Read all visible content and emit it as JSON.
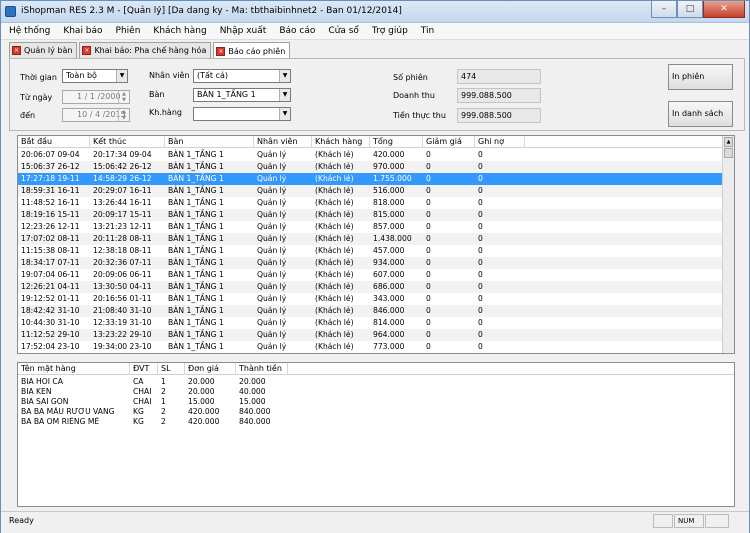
{
  "window": {
    "title": "iShopman RES 2.3 M - [Quản lý] [Da dang ky - Ma: tbthaibinhnet2 - Ban 01/12/2014]"
  },
  "menu": [
    "Hệ thống",
    "Khai báo",
    "Phiên",
    "Khách hàng",
    "Nhập xuất",
    "Báo cáo",
    "Cửa sổ",
    "Trợ giúp",
    "Tin"
  ],
  "tabs": [
    "Quản lý bàn",
    "Khai báo: Pha chế hàng hóa",
    "Báo cáo phiên"
  ],
  "filters": {
    "time_label": "Thời gian",
    "time_value": "Toàn bộ",
    "from_label": "Từ ngày",
    "from_value": "1 / 1 /2000",
    "to_label": "đến",
    "to_value": "10 / 4 /2015",
    "staff_label": "Nhân viên",
    "staff_value": "(Tất cả)",
    "table_label": "Bàn",
    "table_value": "BÀN 1_TẦNG 1",
    "customer_label": "Kh.hàng",
    "customer_value": ""
  },
  "stats": {
    "sessions_label": "Số phiên",
    "sessions_value": "474",
    "revenue_label": "Doanh thu",
    "revenue_value": "999.088.500",
    "cash_label": "Tiền thực thu",
    "cash_value": "999.088.500"
  },
  "buttons": {
    "print_session": "In phiên",
    "print_list": "In danh sách"
  },
  "sessions_grid": {
    "columns": [
      "Bắt đầu",
      "Kết thúc",
      "Bàn",
      "Nhân viên",
      "Khách hàng",
      "Tổng",
      "Giảm giá",
      "Ghi nợ"
    ],
    "rows": [
      [
        "20:06:07  09-04",
        "20:17:34  09-04",
        "BÀN 1_TẦNG 1",
        "Quản lý",
        "(Khách lẻ)",
        "420.000",
        "0",
        "0"
      ],
      [
        "15:06:37  26-12",
        "15:06:42  26-12",
        "BÀN 1_TẦNG 1",
        "Quản lý",
        "(Khách lẻ)",
        "970.000",
        "0",
        "0"
      ],
      [
        "17:27:18  19-11",
        "14:58:29  26-12",
        "BÀN 1_TẦNG 1",
        "Quản lý",
        "(Khách lẻ)",
        "1.755.000",
        "0",
        "0"
      ],
      [
        "18:59:31  16-11",
        "20:29:07  16-11",
        "BÀN 1_TẦNG 1",
        "Quản lý",
        "(Khách lẻ)",
        "516.000",
        "0",
        "0"
      ],
      [
        "11:48:52  16-11",
        "13:26:44  16-11",
        "BÀN 1_TẦNG 1",
        "Quản lý",
        "(Khách lẻ)",
        "818.000",
        "0",
        "0"
      ],
      [
        "18:19:16  15-11",
        "20:09:17  15-11",
        "BÀN 1_TẦNG 1",
        "Quản lý",
        "(Khách lẻ)",
        "815.000",
        "0",
        "0"
      ],
      [
        "12:23:26  12-11",
        "13:21:23  12-11",
        "BÀN 1_TẦNG 1",
        "Quản lý",
        "(Khách lẻ)",
        "857.000",
        "0",
        "0"
      ],
      [
        "17:07:02  08-11",
        "20:11:28  08-11",
        "BÀN 1_TẦNG 1",
        "Quản lý",
        "(Khách lẻ)",
        "1.438.000",
        "0",
        "0"
      ],
      [
        "11:15:38  08-11",
        "12:38:18  08-11",
        "BÀN 1_TẦNG 1",
        "Quản lý",
        "(Khách lẻ)",
        "457.000",
        "0",
        "0"
      ],
      [
        "18:34:17  07-11",
        "20:32:36  07-11",
        "BÀN 1_TẦNG 1",
        "Quản lý",
        "(Khách lẻ)",
        "934.000",
        "0",
        "0"
      ],
      [
        "19:07:04  06-11",
        "20:09:06  06-11",
        "BÀN 1_TẦNG 1",
        "Quản lý",
        "(Khách lẻ)",
        "607.000",
        "0",
        "0"
      ],
      [
        "12:26:21  04-11",
        "13:30:50  04-11",
        "BÀN 1_TẦNG 1",
        "Quản lý",
        "(Khách lẻ)",
        "686.000",
        "0",
        "0"
      ],
      [
        "19:12:52  01-11",
        "20:16:56  01-11",
        "BÀN 1_TẦNG 1",
        "Quản lý",
        "(Khách lẻ)",
        "343.000",
        "0",
        "0"
      ],
      [
        "18:42:42  31-10",
        "21:08:40  31-10",
        "BÀN 1_TẦNG 1",
        "Quản lý",
        "(Khách lẻ)",
        "846.000",
        "0",
        "0"
      ],
      [
        "10:44:30  31-10",
        "12:33:19  31-10",
        "BÀN 1_TẦNG 1",
        "Quản lý",
        "(Khách lẻ)",
        "814.000",
        "0",
        "0"
      ],
      [
        "11:12:52  29-10",
        "13:23:22  29-10",
        "BÀN 1_TẦNG 1",
        "Quản lý",
        "(Khách lẻ)",
        "964.000",
        "0",
        "0"
      ],
      [
        "17:52:04  23-10",
        "19:34:00  23-10",
        "BÀN 1_TẦNG 1",
        "Quản lý",
        "(Khách lẻ)",
        "773.000",
        "0",
        "0"
      ]
    ],
    "selected_row": 2
  },
  "items_grid": {
    "columns": [
      "Tên mặt hàng",
      "ĐVT",
      "SL",
      "Đơn giá",
      "Thành tiền"
    ],
    "rows": [
      [
        "BIA HOI CA",
        "CA",
        "1",
        "20.000",
        "20.000"
      ],
      [
        "BIA KEN",
        "CHAI",
        "2",
        "20.000",
        "40.000"
      ],
      [
        "BIA SAI GON",
        "CHAI",
        "1",
        "15.000",
        "15.000"
      ],
      [
        "BA BA MÂU RƯƠU VANG",
        "KG",
        "2",
        "420.000",
        "840.000"
      ],
      [
        "BA BA OM RIÊNG MÊ",
        "KG",
        "2",
        "420.000",
        "840.000"
      ]
    ]
  },
  "status": {
    "ready": "Ready",
    "num": "NUM"
  },
  "colors": {
    "selection": "#3399ff",
    "tab_icon": "#d9382b"
  }
}
